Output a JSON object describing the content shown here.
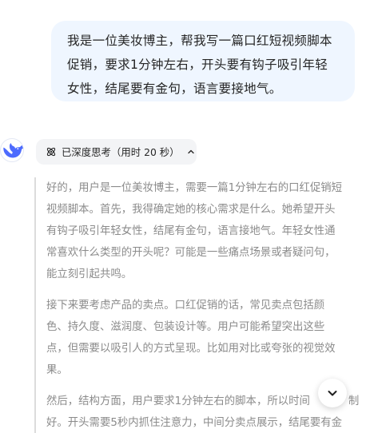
{
  "user_message": {
    "lines": [
      "我是一位美妆博主，帮我写一篇口红短视频脚本",
      "促销，要求1分钟左右，开头要有钩子吸引年轻",
      "女性，结尾要有金句，语言要接地气。"
    ]
  },
  "assistant": {
    "avatar_icon": "whale-logo-icon",
    "brand_color": "#4d6bfe",
    "think_chip": {
      "label": "已深度思考（用时 20 秒）",
      "icon": "atom-icon",
      "caret_icon": "chevron-up-icon"
    },
    "thought_paragraphs": [
      {
        "lines": [
          "好的，用户是一位美妆博主，需要一篇1分钟左右的口红促销短",
          "视频脚本。首先，我得确定她的核心需求是什么。她希望开头",
          "有钩子吸引年轻女性，结尾有金句，语言接地气。年轻女性通",
          "常喜欢什么类型的开头呢？可能是一些痛点场景或者疑问句，",
          "能立刻引起共鸣。"
        ]
      },
      {
        "lines": [
          "接下来要考虑产品的卖点。口红促销的话，常见卖点包括颜",
          "色、持久度、滋润度、包装设计等。用户可能希望突出这些",
          "点，但需要以吸引人的方式呈现。比如用对比或夸张的视觉效",
          "果。"
        ]
      },
      {
        "lines": [
          "然后，结构方面，用户要求1分钟左右的脚本，所以时间",
          "好。开头需要5秒内抓住注意力，中间分卖点展示，结尾要有金"
        ],
        "line_suffixes": [
          "制",
          ""
        ]
      }
    ]
  },
  "scroll_button": {
    "icon": "chevron-down-icon"
  }
}
